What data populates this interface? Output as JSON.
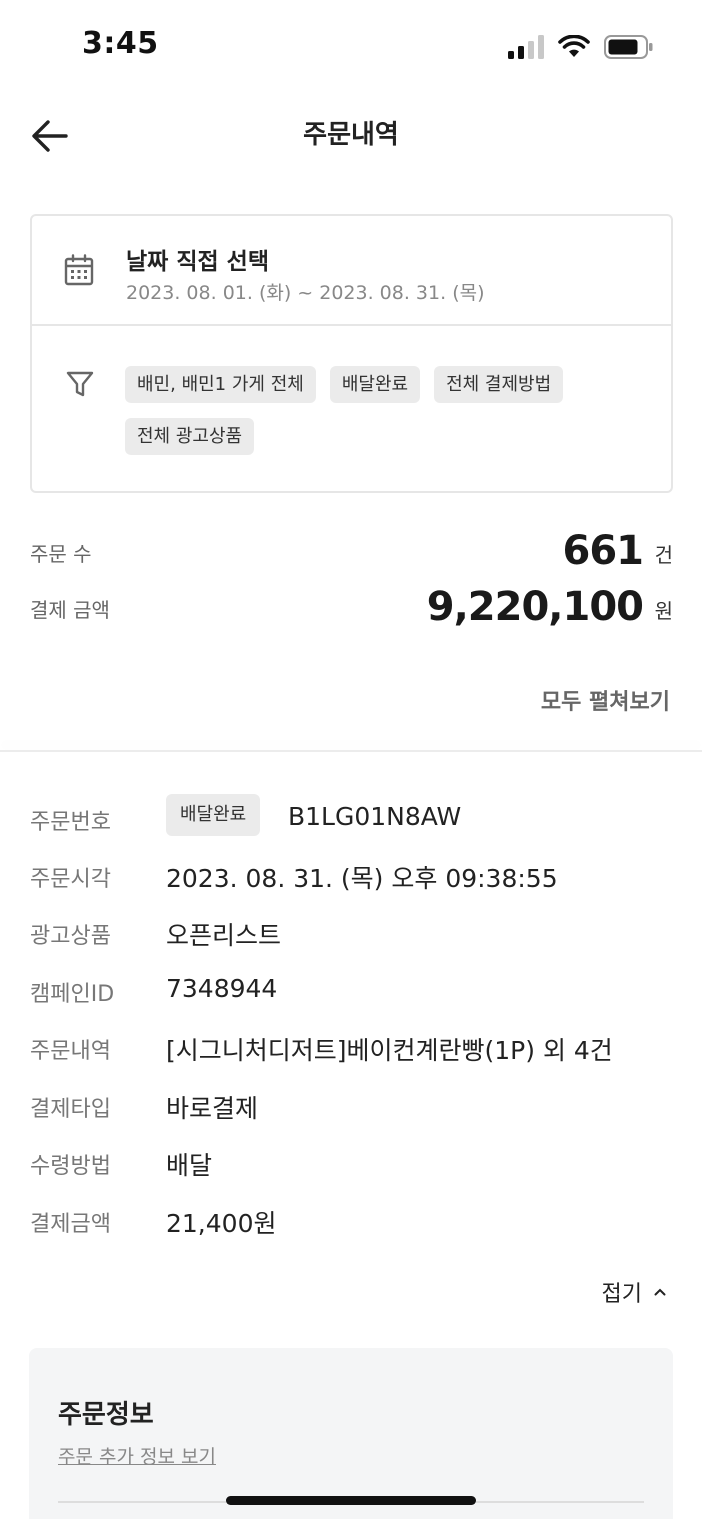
{
  "status_bar": {
    "time": "3:45"
  },
  "header": {
    "title": "주문내역"
  },
  "filter": {
    "date_title": "날짜 직접 선택",
    "date_range": "2023. 08. 01. (화) ~ 2023. 08. 31. (목)",
    "chips": [
      "배민, 배민1 가게 전체",
      "배달완료",
      "전체 결제방법",
      "전체 광고상품"
    ]
  },
  "summary": {
    "order_count_label": "주문 수",
    "order_count_value": "661",
    "order_count_unit": "건",
    "payment_label": "결제 금액",
    "payment_value": "9,220,100",
    "payment_unit": "원",
    "expand_all": "모두 펼쳐보기"
  },
  "order": {
    "number_label": "주문번호",
    "status_badge": "배달완료",
    "number": "B1LG01N8AW",
    "time_label": "주문시각",
    "time": "2023. 08. 31. (목) 오후 09:38:55",
    "ad_label": "광고상품",
    "ad": "오픈리스트",
    "campaign_label": "캠페인ID",
    "campaign": "7348944",
    "items_label": "주문내역",
    "items": "[시그니처디저트]베이컨계란빵(1P) 외 4건",
    "pay_type_label": "결제타입",
    "pay_type": "바로결제",
    "receive_label": "수령방법",
    "receive": "배달",
    "amount_label": "결제금액",
    "amount": "21,400원",
    "collapse": "접기"
  },
  "order_info": {
    "title": "주문정보",
    "more_link": "주문 추가 정보 보기"
  }
}
